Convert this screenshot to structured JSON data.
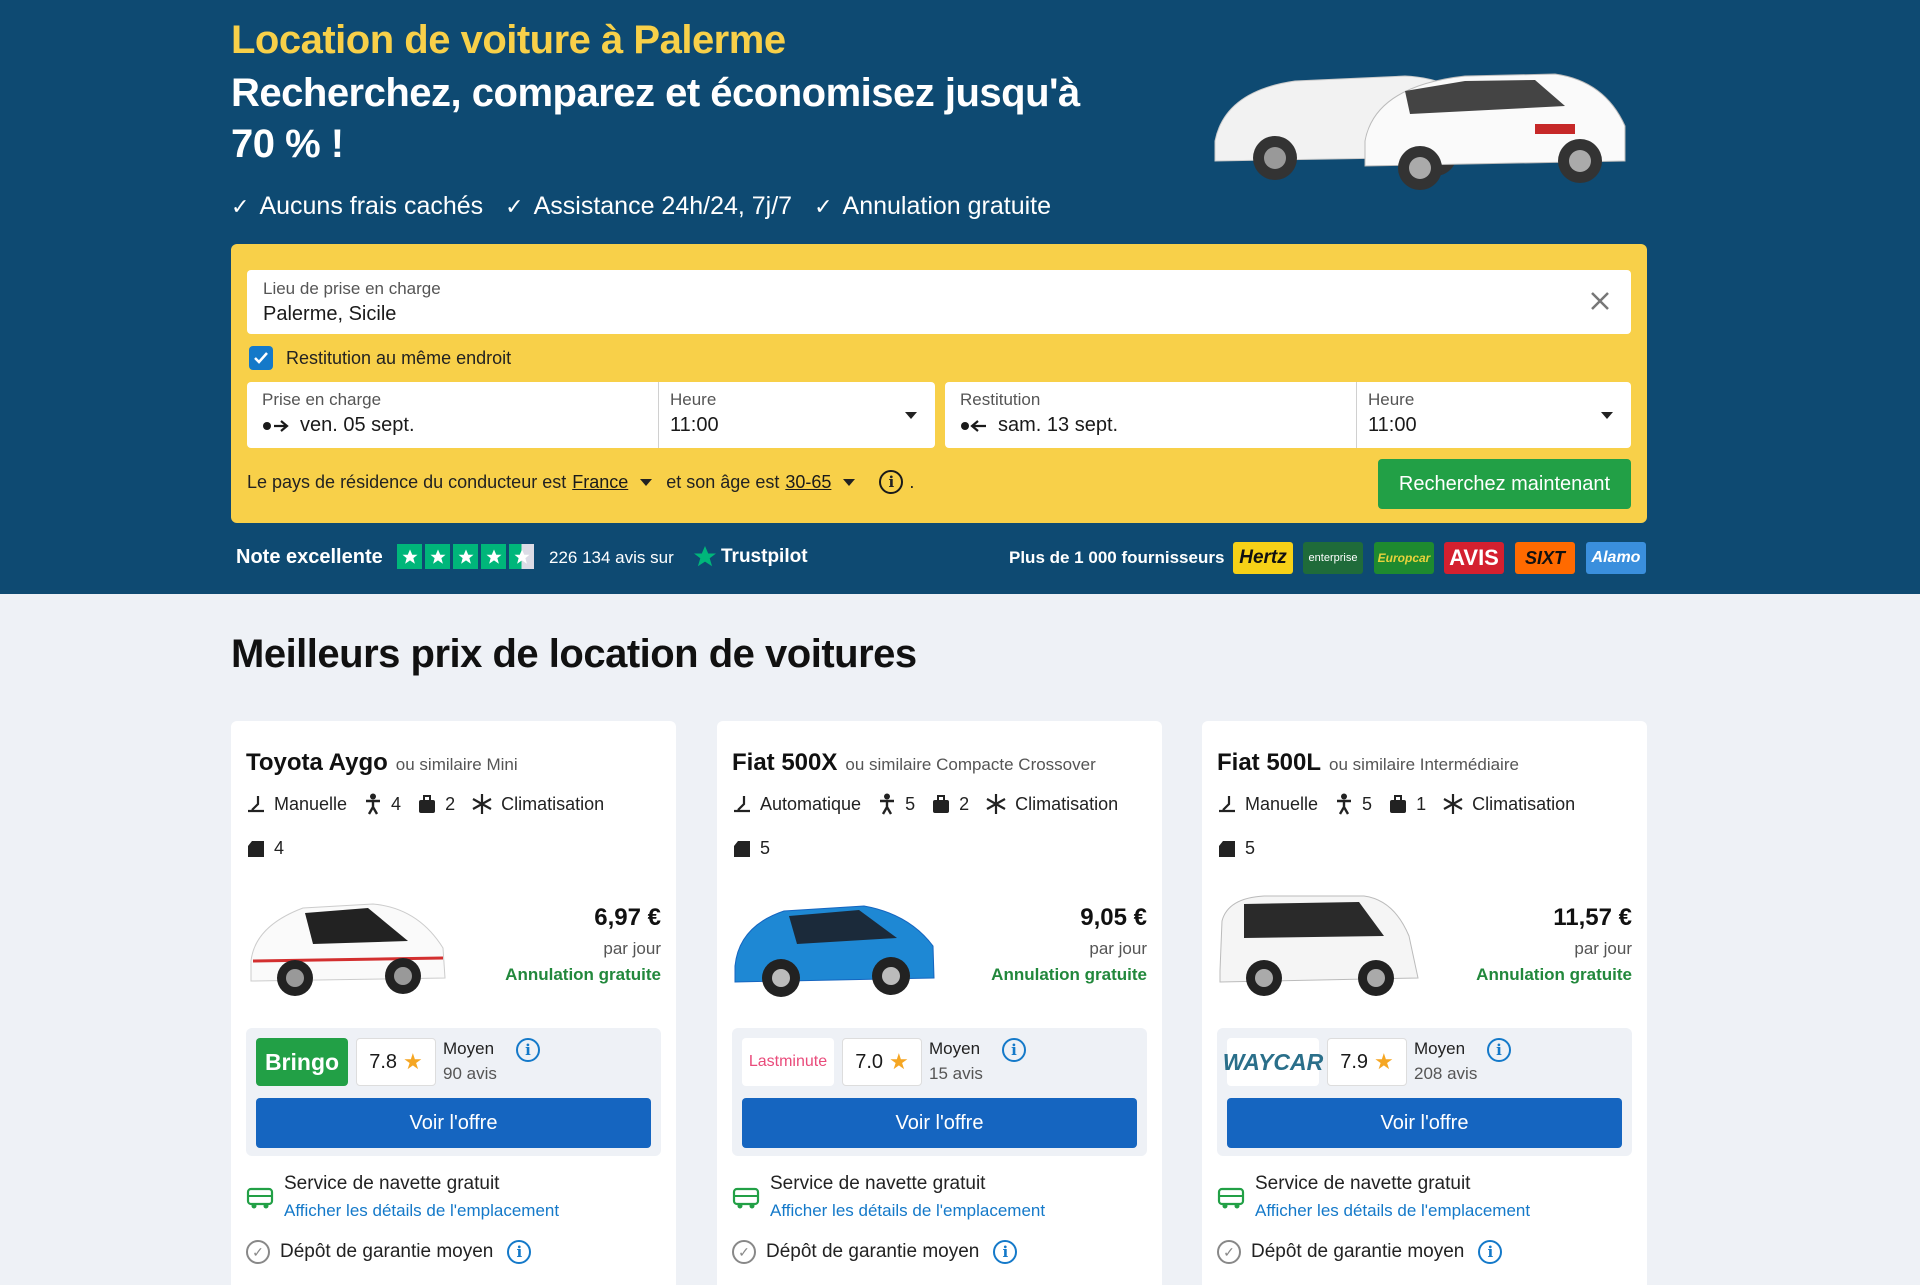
{
  "hero": {
    "title": "Location de voiture à Palerme",
    "subtitle": "Recherchez, comparez et économisez jusqu'à 70 % !",
    "perks": [
      "Aucuns frais cachés",
      "Assistance 24h/24, 7j/7",
      "Annulation gratuite"
    ]
  },
  "search": {
    "pickup_label": "Lieu de prise en charge",
    "pickup_value": "Palerme, Sicile",
    "same_return_label": "Restitution au même endroit",
    "same_return_checked": true,
    "pickup_date_label": "Prise en charge",
    "pickup_date_value": "ven. 05 sept.",
    "pickup_time_label": "Heure",
    "pickup_time_value": "11:00",
    "return_date_label": "Restitution",
    "return_date_value": "sam. 13 sept.",
    "return_time_label": "Heure",
    "return_time_value": "11:00",
    "residence_text": "Le pays de résidence du conducteur est",
    "residence_country": "France",
    "age_text": "et son âge est",
    "age_value": "30-65",
    "period": ".",
    "submit_label": "Recherchez maintenant"
  },
  "trust": {
    "label": "Note excellente",
    "reviews": "226 134 avis sur",
    "brand": "Trustpilot",
    "suppliers_label": "Plus de 1 000 fournisseurs",
    "brands": [
      "Hertz",
      "enterprise",
      "Europcar",
      "AVIS",
      "SIXT",
      "Alamo"
    ]
  },
  "section": {
    "title": "Meilleurs prix de location de voitures"
  },
  "cards": [
    {
      "name": "Toyota Aygo",
      "similar": "ou similaire Mini",
      "transmission": "Manuelle",
      "seats": "4",
      "bags": "2",
      "ac": "Climatisation",
      "doors": "4",
      "price": "6,97 €",
      "per_day": "par jour",
      "cancel": "Annulation gratuite",
      "supplier": "Bringo",
      "rating": "7.8",
      "rating_label": "Moyen",
      "reviews": "90 avis",
      "offer": "Voir l'offre",
      "shuttle": "Service de navette gratuit",
      "location_link": "Afficher les détails de l'emplacement",
      "deposit": "Dépôt de garantie moyen"
    },
    {
      "name": "Fiat 500X",
      "similar": "ou similaire Compacte Crossover",
      "transmission": "Automatique",
      "seats": "5",
      "bags": "2",
      "ac": "Climatisation",
      "doors": "5",
      "price": "9,05 €",
      "per_day": "par jour",
      "cancel": "Annulation gratuite",
      "supplier": "Lastminute",
      "rating": "7.0",
      "rating_label": "Moyen",
      "reviews": "15 avis",
      "offer": "Voir l'offre",
      "shuttle": "Service de navette gratuit",
      "location_link": "Afficher les détails de l'emplacement",
      "deposit": "Dépôt de garantie moyen"
    },
    {
      "name": "Fiat 500L",
      "similar": "ou similaire Intermédiaire",
      "transmission": "Manuelle",
      "seats": "5",
      "bags": "1",
      "ac": "Climatisation",
      "doors": "5",
      "price": "11,57 €",
      "per_day": "par jour",
      "cancel": "Annulation gratuite",
      "supplier": "WAYCAR",
      "rating": "7.9",
      "rating_label": "Moyen",
      "reviews": "208 avis",
      "offer": "Voir l'offre",
      "shuttle": "Service de navette gratuit",
      "location_link": "Afficher les détails de l'emplacement",
      "deposit": "Dépôt de garantie moyen"
    }
  ],
  "colors": {
    "hero_bg": "#0e4a72",
    "accent_yellow": "#f8d049",
    "search_green": "#22a046",
    "offer_blue": "#1565c0",
    "link_blue": "#1479c9",
    "trust_green": "#00b67a"
  }
}
